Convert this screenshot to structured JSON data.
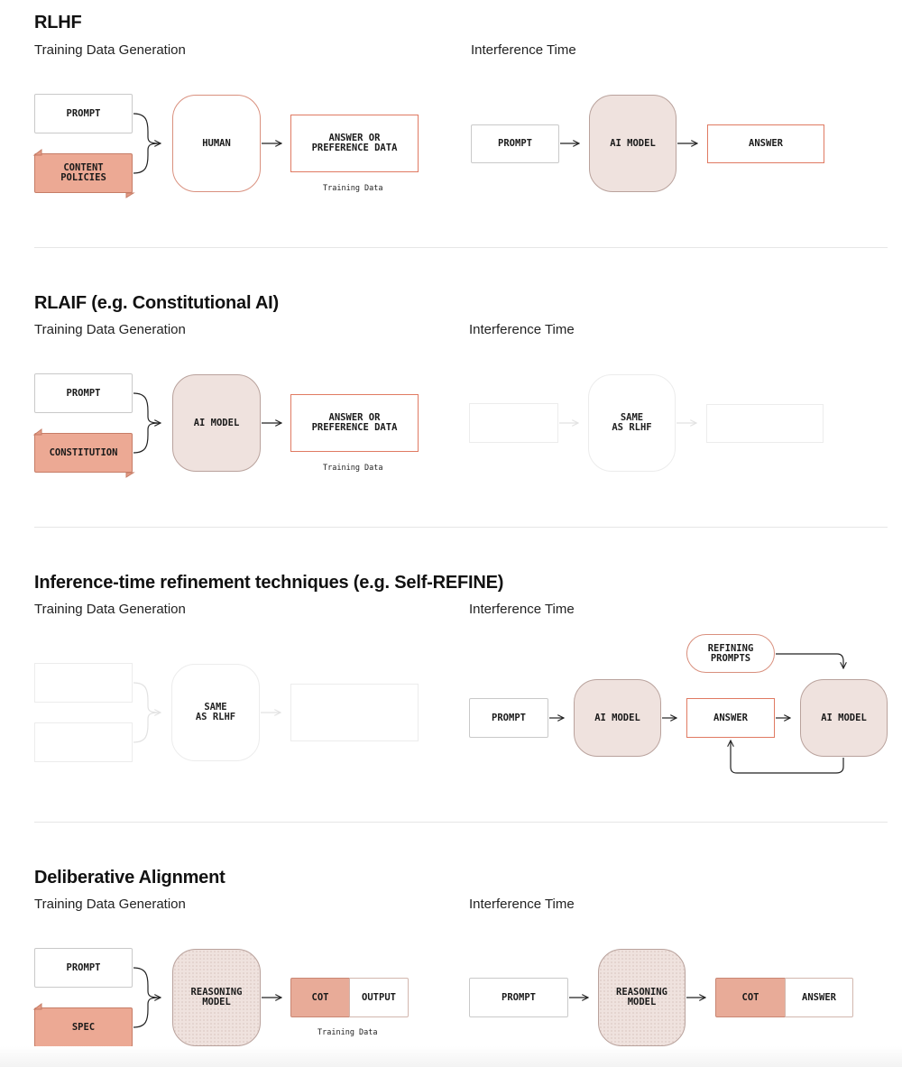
{
  "sections": [
    {
      "title": "RLHF",
      "training_label": "Training Data Generation",
      "inference_label": "Interference Time",
      "training": {
        "input_top": "PROMPT",
        "input_bottom": "CONTENT\nPOLICIES",
        "center": "HUMAN",
        "output": "ANSWER OR\nPREFERENCE DATA",
        "caption": "Training Data"
      },
      "inference": {
        "input": "PROMPT",
        "model": "AI MODEL",
        "output": "ANSWER"
      }
    },
    {
      "title": "RLAIF (e.g. Constitutional AI)",
      "training_label": "Training Data Generation",
      "inference_label": "Interference Time",
      "training": {
        "input_top": "PROMPT",
        "input_bottom": "CONSTITUTION",
        "center": "AI MODEL",
        "output": "ANSWER OR\nPREFERENCE DATA",
        "caption": "Training Data"
      },
      "inference": {
        "center": "SAME\nAS RLHF"
      }
    },
    {
      "title": "Inference-time refinement techniques (e.g. Self-REFINE)",
      "training_label": "Training Data Generation",
      "inference_label": "Interference Time",
      "training": {
        "center": "SAME\nAS RLHF"
      },
      "inference": {
        "input": "PROMPT",
        "model": "AI MODEL",
        "output": "ANSWER",
        "refine": "REFINING\nPROMPTS",
        "model2": "AI MODEL"
      }
    },
    {
      "title": "Deliberative Alignment",
      "training_label": "Training Data Generation",
      "inference_label": "Interference Time",
      "training": {
        "input_top": "PROMPT",
        "input_bottom": "SPEC",
        "center": "REASONING\nMODEL",
        "output_left": "COT",
        "output_right": "OUTPUT",
        "caption": "Training Data"
      },
      "inference": {
        "input": "PROMPT",
        "model": "REASONING\nMODEL",
        "output_left": "COT",
        "output_right": "ANSWER"
      }
    }
  ],
  "colors": {
    "accent": "#e07a62",
    "model_fill": "#efe2de",
    "scroll_fill": "#eca994"
  }
}
